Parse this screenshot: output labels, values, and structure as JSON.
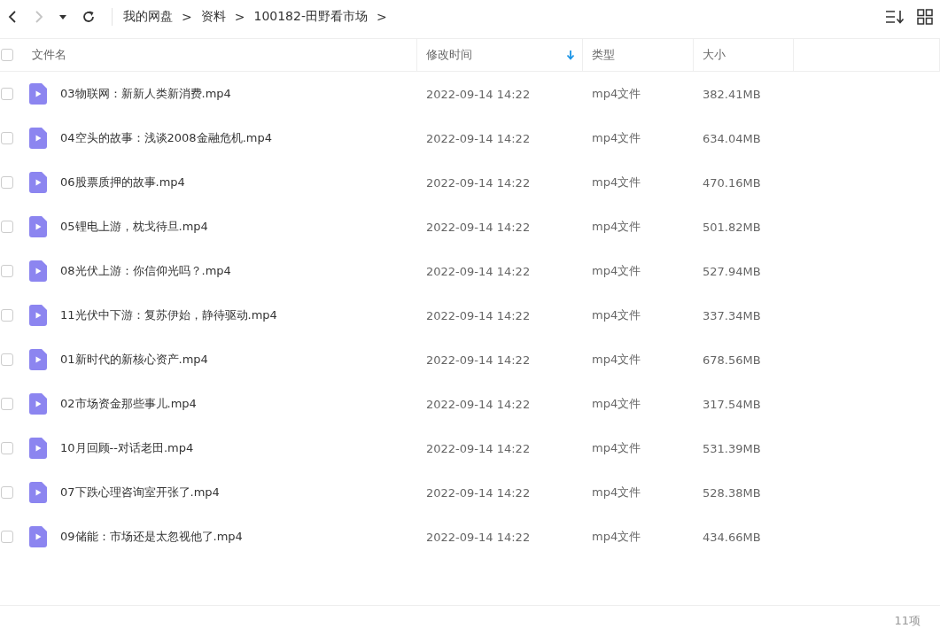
{
  "toolbar": {
    "nav": [
      {
        "kind": "back",
        "disabled": false
      },
      {
        "kind": "forward",
        "disabled": true
      },
      {
        "kind": "history",
        "disabled": false
      },
      {
        "kind": "refresh",
        "disabled": false
      }
    ],
    "breadcrumb": [
      "我的网盘",
      "资料",
      "100182-田野看市场"
    ],
    "separator": ">"
  },
  "table": {
    "select_all": {
      "checked": false
    },
    "columns": [
      {
        "label": "文件名",
        "sorted": false
      },
      {
        "label": "修改时间",
        "sorted": true
      },
      {
        "label": "类型",
        "sorted": false
      },
      {
        "label": "大小",
        "sorted": false
      }
    ],
    "rows": [
      {
        "checked": false,
        "name": "03物联网：新新人类新消费.mp4",
        "modified": "2022-09-14 14:22",
        "type": "mp4文件",
        "size": "382.41MB"
      },
      {
        "checked": false,
        "name": "04空头的故事：浅谈2008金融危机.mp4",
        "modified": "2022-09-14 14:22",
        "type": "mp4文件",
        "size": "634.04MB"
      },
      {
        "checked": false,
        "name": "06股票质押的故事.mp4",
        "modified": "2022-09-14 14:22",
        "type": "mp4文件",
        "size": "470.16MB"
      },
      {
        "checked": false,
        "name": "05锂电上游，枕戈待旦.mp4",
        "modified": "2022-09-14 14:22",
        "type": "mp4文件",
        "size": "501.82MB"
      },
      {
        "checked": false,
        "name": "08光伏上游：你信仰光吗？.mp4",
        "modified": "2022-09-14 14:22",
        "type": "mp4文件",
        "size": "527.94MB"
      },
      {
        "checked": false,
        "name": "11光伏中下游：复苏伊始，静待驱动.mp4",
        "modified": "2022-09-14 14:22",
        "type": "mp4文件",
        "size": "337.34MB"
      },
      {
        "checked": false,
        "name": "01新时代的新核心资产.mp4",
        "modified": "2022-09-14 14:22",
        "type": "mp4文件",
        "size": "678.56MB"
      },
      {
        "checked": false,
        "name": "02市场资金那些事儿.mp4",
        "modified": "2022-09-14 14:22",
        "type": "mp4文件",
        "size": "317.54MB"
      },
      {
        "checked": false,
        "name": "10月回顾--对话老田.mp4",
        "modified": "2022-09-14 14:22",
        "type": "mp4文件",
        "size": "531.39MB"
      },
      {
        "checked": false,
        "name": "07下跌心理咨询室开张了.mp4",
        "modified": "2022-09-14 14:22",
        "type": "mp4文件",
        "size": "528.38MB"
      },
      {
        "checked": false,
        "name": "09储能：市场还是太忽视他了.mp4",
        "modified": "2022-09-14 14:22",
        "type": "mp4文件",
        "size": "434.66MB"
      }
    ]
  },
  "status_bar": {
    "count": "11项"
  }
}
